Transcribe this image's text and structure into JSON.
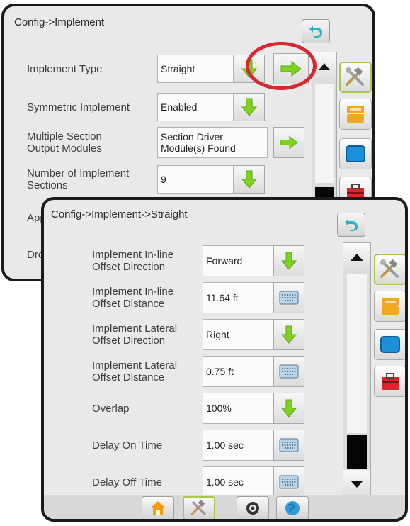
{
  "back_screen": {
    "title": "Config->Implement",
    "rows": [
      {
        "label": "Implement Type",
        "value": "Straight"
      },
      {
        "label": "Symmetric Implement",
        "value": "Enabled"
      },
      {
        "label": "Multiple Section Output Modules",
        "value": "Section Driver Module(s) Found"
      },
      {
        "label": "Number of Implement Sections",
        "value": "9"
      },
      {
        "label": "App",
        "value": ""
      },
      {
        "label": "Dro",
        "value": ""
      }
    ]
  },
  "front_screen": {
    "title": "Config->Implement->Straight",
    "rows": [
      {
        "label": "Implement In-line Offset Direction",
        "value": "Forward",
        "control": "dropdown"
      },
      {
        "label": "Implement In-line Offset Distance",
        "value": "11.64 ft",
        "control": "keyboard"
      },
      {
        "label": "Implement Lateral Offset Direction",
        "value": "Right",
        "control": "dropdown"
      },
      {
        "label": "Implement Lateral Offset Distance",
        "value": "0.75 ft",
        "control": "keyboard"
      },
      {
        "label": "Overlap",
        "value": "100%",
        "control": "dropdown"
      },
      {
        "label": "Delay On Time",
        "value": "1.00 sec",
        "control": "keyboard"
      },
      {
        "label": "Delay Off Time",
        "value": "1.00 sec",
        "control": "keyboard"
      }
    ]
  },
  "side_tabs": [
    "tools-icon",
    "console-icon",
    "screen-icon",
    "toolbox-icon"
  ],
  "bottom_tabs": [
    "home-icon",
    "tools-icon",
    "gps-icon",
    "globe-icon"
  ],
  "colors": {
    "accent_green": "#7ed321",
    "highlight_red": "#d9272e",
    "selected_tab_border": "#a8c84a"
  }
}
